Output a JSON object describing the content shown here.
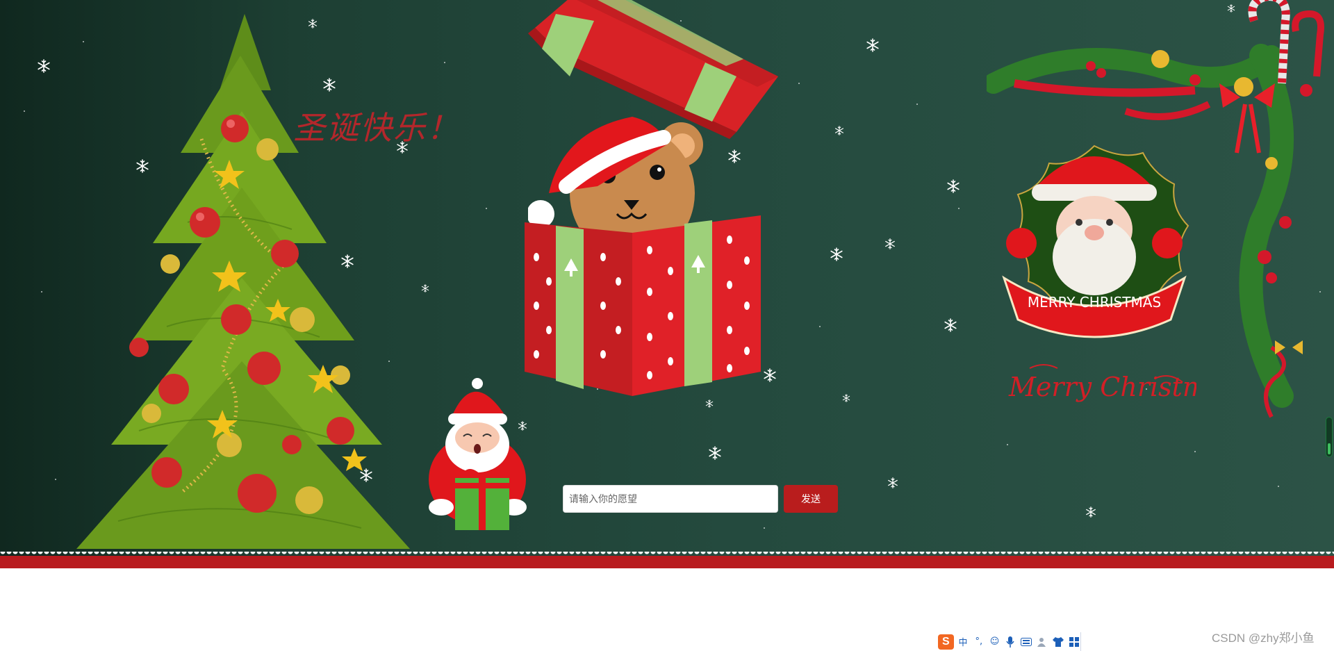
{
  "page": {
    "greeting_cn": "圣诞快乐！",
    "badge_text": "MERRY CHRISTMAS",
    "script_text": "Merry Christmas"
  },
  "wish_form": {
    "placeholder": "请输入你的愿望",
    "value": "",
    "send_label": "发送"
  },
  "watermark": "CSDN @zhy郑小鱼",
  "ime_toolbar": {
    "logo": "S",
    "mode_label": "中",
    "icons": [
      "punctuation-icon",
      "emoji-icon",
      "microphone-icon",
      "keyboard-icon",
      "user-icon",
      "skin-icon",
      "apps-grid-icon"
    ]
  },
  "colors": {
    "background_dark": "#10281f",
    "background_light": "#2c5346",
    "accent_red": "#b91d1d",
    "title_red": "#b3272b",
    "band_red": "#b81b1e"
  }
}
